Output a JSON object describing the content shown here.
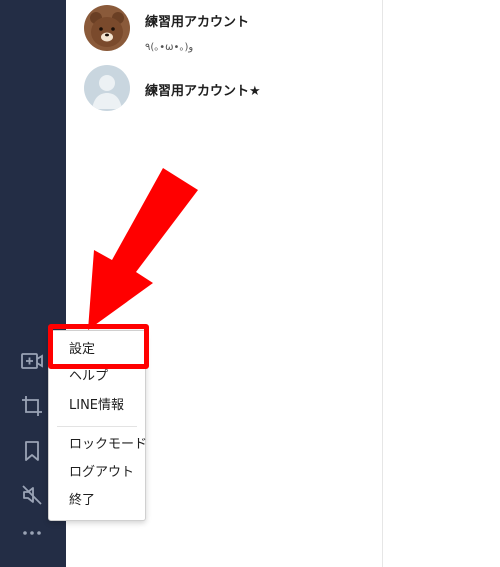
{
  "sidebar": {
    "icons": [
      "add-video-icon",
      "crop-icon",
      "bookmark-icon",
      "mute-icon",
      "more-icon"
    ],
    "color": "#232d45",
    "icon_color": "#9aa3b5"
  },
  "friends": [
    {
      "name": "練習用アカウント",
      "status": "٩(｡•ω•｡)و",
      "avatar": "bear-avatar"
    },
    {
      "name": "練習用アカウント★",
      "status": "",
      "avatar": "default-avatar"
    }
  ],
  "menu": {
    "items": [
      "設定",
      "ヘルプ",
      "LINE情報",
      "ロックモード",
      "ログアウト",
      "終了"
    ]
  },
  "annotation": {
    "color": "#ff0000"
  }
}
